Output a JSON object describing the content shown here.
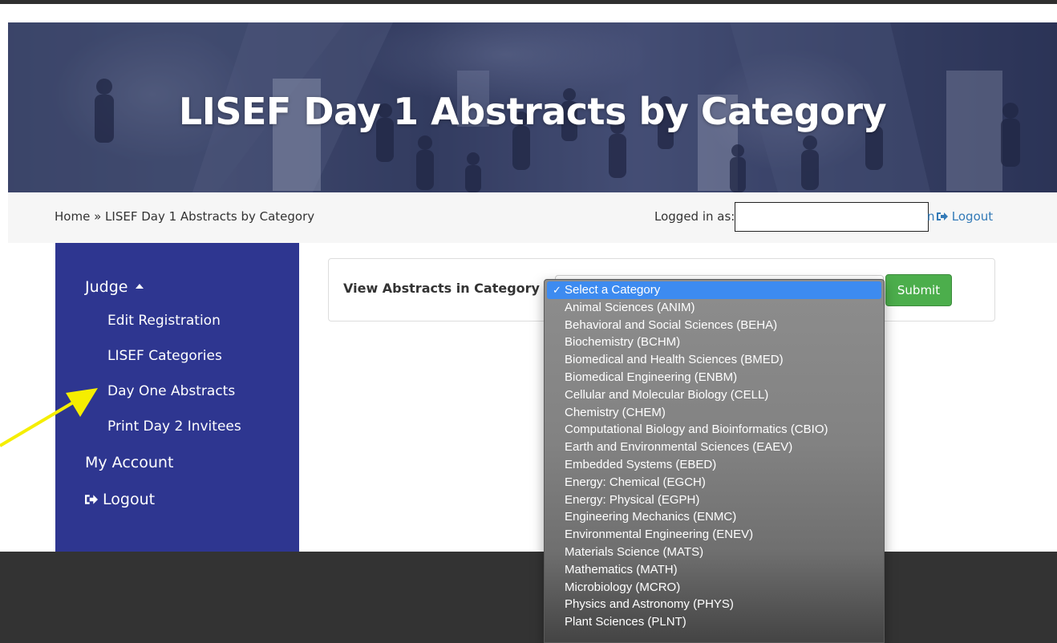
{
  "page": {
    "title": "LISEF Day 1 Abstracts by Category"
  },
  "breadcrumb": {
    "home": "Home",
    "separator": "»",
    "current": "LISEF Day 1 Abstracts by Category"
  },
  "auth": {
    "logged_in_label": "Logged in as:",
    "username_tail": "n",
    "logout_label": "Logout",
    "logout_icon": "sign-out-icon"
  },
  "sidebar": {
    "items": [
      {
        "label": "Judge",
        "expanded": true
      },
      {
        "label": "Edit Registration"
      },
      {
        "label": "LISEF Categories"
      },
      {
        "label": "Day One Abstracts"
      },
      {
        "label": "Print Day 2 Invitees"
      },
      {
        "label": "My Account"
      },
      {
        "label": "Logout",
        "icon": "sign-out-icon"
      }
    ]
  },
  "form": {
    "label": "View Abstracts in Category",
    "submit_label": "Submit",
    "selected": "Select a Category",
    "options": [
      "Select a Category",
      "Animal Sciences (ANIM)",
      "Behavioral and Social Sciences (BEHA)",
      "Biochemistry (BCHM)",
      "Biomedical and Health Sciences (BMED)",
      "Biomedical Engineering (ENBM)",
      "Cellular and Molecular Biology (CELL)",
      "Chemistry (CHEM)",
      "Computational Biology and Bioinformatics (CBIO)",
      "Earth and Environmental Sciences (EAEV)",
      "Embedded Systems (EBED)",
      "Energy: Chemical (EGCH)",
      "Energy: Physical (EGPH)",
      "Engineering Mechanics (ENMC)",
      "Environmental Engineering (ENEV)",
      "Materials Science (MATS)",
      "Mathematics (MATH)",
      "Microbiology (MCRO)",
      "Physics and Astronomy (PHYS)",
      "Plant Sciences (PLNT)"
    ],
    "check_mark": "✓"
  },
  "colors": {
    "sidebar_bg": "#2e3690",
    "submit_bg": "#4cae4c",
    "link": "#337ab7",
    "selected_option": "#3d8bf0",
    "annotation_arrow": "#f5ee00"
  }
}
